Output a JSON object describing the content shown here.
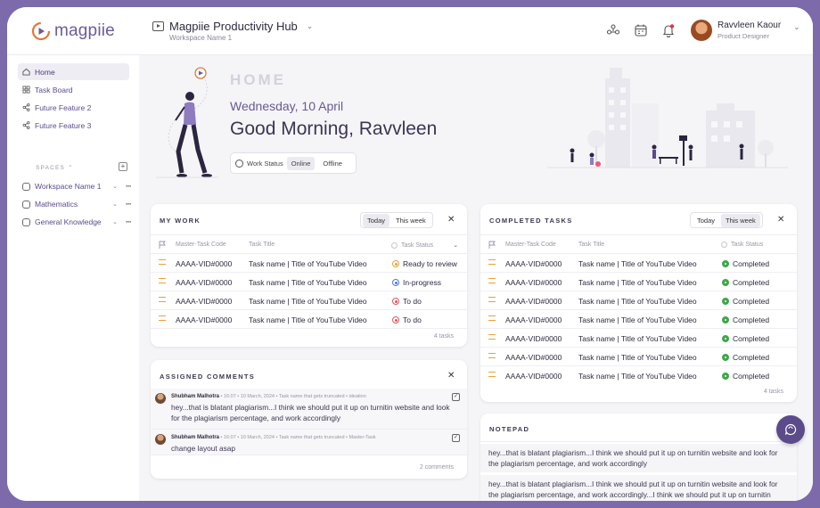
{
  "brand": {
    "name": "magpiie",
    "accent": "#6d5a9a",
    "frame": "#7d6aab"
  },
  "topbar": {
    "hub_title": "Magpiie Productivity Hub",
    "workspace": "Workspace Name 1",
    "icons": [
      "team-icon",
      "calendar-icon",
      "bell-icon"
    ],
    "user_name": "Ravvleen Kaour",
    "user_role": "Product Designer"
  },
  "sidebar": {
    "items": [
      {
        "label": "Home",
        "icon": "home-icon",
        "active": true
      },
      {
        "label": "Task Board",
        "icon": "grid-icon"
      },
      {
        "label": "Future Feature 2",
        "icon": "share-icon"
      },
      {
        "label": "Future Feature 3",
        "icon": "share-icon"
      }
    ],
    "spaces_label": "SPACES",
    "spaces": [
      {
        "label": "Workspace Name 1"
      },
      {
        "label": "Mathematics"
      },
      {
        "label": "General Knowledge"
      }
    ]
  },
  "hero": {
    "home_label": "HOME",
    "date": "Wednesday, 10 April",
    "greeting": "Good Morning, Ravvleen",
    "work_status_label": "Work Status",
    "online": "Online",
    "offline": "Offline"
  },
  "my_work": {
    "title": "MY WORK",
    "tab_today": "Today",
    "tab_week": "This week",
    "col_code": "Master-Task Code",
    "col_title": "Task Title",
    "col_status": "Task Status",
    "rows": [
      {
        "code": "AAAA-VID#0000",
        "title": "Task name | Title of YouTube Video",
        "status": "Ready to review",
        "color": "orange"
      },
      {
        "code": "AAAA-VID#0000",
        "title": "Task name | Title of YouTube Video",
        "status": "In-progress",
        "color": "blue"
      },
      {
        "code": "AAAA-VID#0000",
        "title": "Task name | Title of YouTube Video",
        "status": "To do",
        "color": "red"
      },
      {
        "code": "AAAA-VID#0000",
        "title": "Task name | Title of YouTube Video",
        "status": "To do",
        "color": "red"
      }
    ],
    "count": "4 tasks"
  },
  "completed": {
    "title": "COMPLETED TASKS",
    "tab_today": "Today",
    "tab_week": "This week",
    "col_code": "Master-Task Code",
    "col_title": "Task Title",
    "col_status": "Task Status",
    "rows": [
      {
        "code": "AAAA-VID#0000",
        "title": "Task name | Title of YouTube Video",
        "status": "Completed"
      },
      {
        "code": "AAAA-VID#0000",
        "title": "Task name | Title of YouTube Video",
        "status": "Completed"
      },
      {
        "code": "AAAA-VID#0000",
        "title": "Task name | Title of YouTube Video",
        "status": "Completed"
      },
      {
        "code": "AAAA-VID#0000",
        "title": "Task name | Title of YouTube Video",
        "status": "Completed"
      },
      {
        "code": "AAAA-VID#0000",
        "title": "Task name | Title of YouTube Video",
        "status": "Completed"
      },
      {
        "code": "AAAA-VID#0000",
        "title": "Task name | Title of YouTube Video",
        "status": "Completed"
      },
      {
        "code": "AAAA-VID#0000",
        "title": "Task name | Title of YouTube Video",
        "status": "Completed"
      }
    ],
    "count": "4 tasks"
  },
  "comments": {
    "title": "ASSIGNED COMMENTS",
    "items": [
      {
        "author": "Shubham Malhotra",
        "meta": " • 16:07 • 10 March, 2024 • Task name that gets truncated • ideation",
        "body": "hey...that is blatant plagiarism...I think we should put it up on turnitin website and look for the plagiarism percentage, and work accordingly"
      },
      {
        "author": "Shubham Malhotra",
        "meta": " • 16:07 • 10 March, 2024 • Task name that gets truncated • Master-Task",
        "body": "change layout asap"
      }
    ],
    "count": "2 comments"
  },
  "notepad": {
    "title": "NOTEPAD",
    "notes": [
      "hey...that is blatant plagiarism...I think we should put it up on turnitin website and look for the plagiarism percentage, and work accordingly",
      "hey...that is blatant plagiarism...I think we should put it up on turnitin website and look for the plagiarism percentage, and work accordingly...I think we should put it up on turnitin website and look for the plagiarism percentage, and work accordingly"
    ]
  }
}
